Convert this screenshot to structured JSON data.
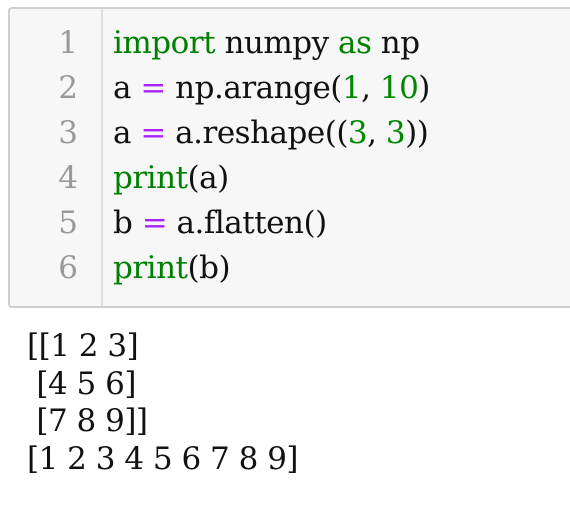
{
  "code_cell": {
    "lines": [
      {
        "number": "1",
        "tokens": [
          {
            "text": "import",
            "type": "kw"
          },
          {
            "text": " numpy ",
            "type": "plain"
          },
          {
            "text": "as",
            "type": "kw"
          },
          {
            "text": " np",
            "type": "plain"
          }
        ]
      },
      {
        "number": "2",
        "tokens": [
          {
            "text": "a ",
            "type": "plain"
          },
          {
            "text": "=",
            "type": "op"
          },
          {
            "text": " np.arange(",
            "type": "plain"
          },
          {
            "text": "1",
            "type": "num"
          },
          {
            "text": ", ",
            "type": "plain"
          },
          {
            "text": "10",
            "type": "num"
          },
          {
            "text": ")",
            "type": "plain"
          }
        ]
      },
      {
        "number": "3",
        "tokens": [
          {
            "text": "a ",
            "type": "plain"
          },
          {
            "text": "=",
            "type": "op"
          },
          {
            "text": " a.reshape((",
            "type": "plain"
          },
          {
            "text": "3",
            "type": "num"
          },
          {
            "text": ", ",
            "type": "plain"
          },
          {
            "text": "3",
            "type": "num"
          },
          {
            "text": "))",
            "type": "plain"
          }
        ]
      },
      {
        "number": "4",
        "tokens": [
          {
            "text": "print",
            "type": "kw"
          },
          {
            "text": "(a)",
            "type": "plain"
          }
        ]
      },
      {
        "number": "5",
        "tokens": [
          {
            "text": "b ",
            "type": "plain"
          },
          {
            "text": "=",
            "type": "op"
          },
          {
            "text": " a.flatten()",
            "type": "plain"
          }
        ]
      },
      {
        "number": "6",
        "tokens": [
          {
            "text": "print",
            "type": "kw"
          },
          {
            "text": "(b)",
            "type": "plain"
          }
        ]
      }
    ]
  },
  "output": {
    "lines": [
      "[[1 2 3]",
      " [4 5 6]",
      " [7 8 9]]",
      "[1 2 3 4 5 6 7 8 9]"
    ]
  },
  "colors": {
    "keyword": "#008000",
    "operator": "#aa22ff",
    "number": "#008800",
    "line_number": "#999999",
    "cell_background": "#f7f7f7",
    "cell_border": "#cfcfcf"
  }
}
